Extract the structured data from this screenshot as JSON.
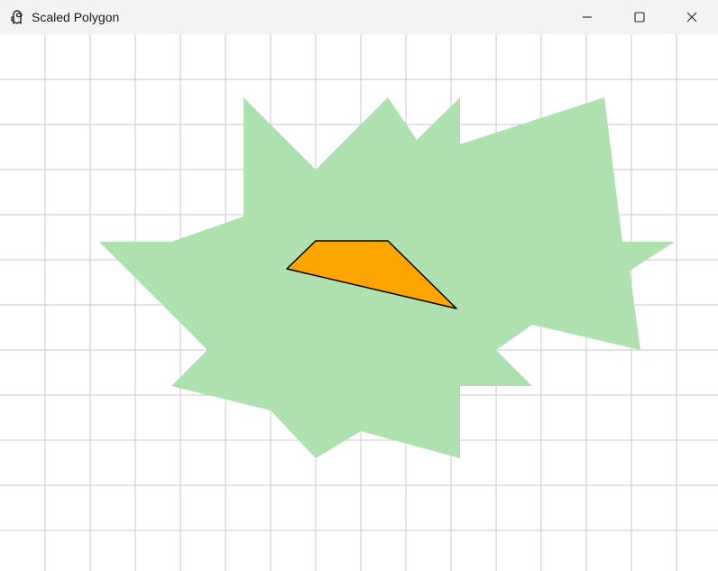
{
  "window": {
    "title": "Scaled Polygon",
    "icon": "app-icon"
  },
  "controls": {
    "minimize": "minimize-icon",
    "maximize": "maximize-icon",
    "close": "close-icon"
  },
  "colors": {
    "grid": "#c8c8c8",
    "scaled_fill": "#aee0b0",
    "polygon_fill": "#ffa500",
    "polygon_stroke": "#000000",
    "titlebar": "#f3f3f3"
  }
}
